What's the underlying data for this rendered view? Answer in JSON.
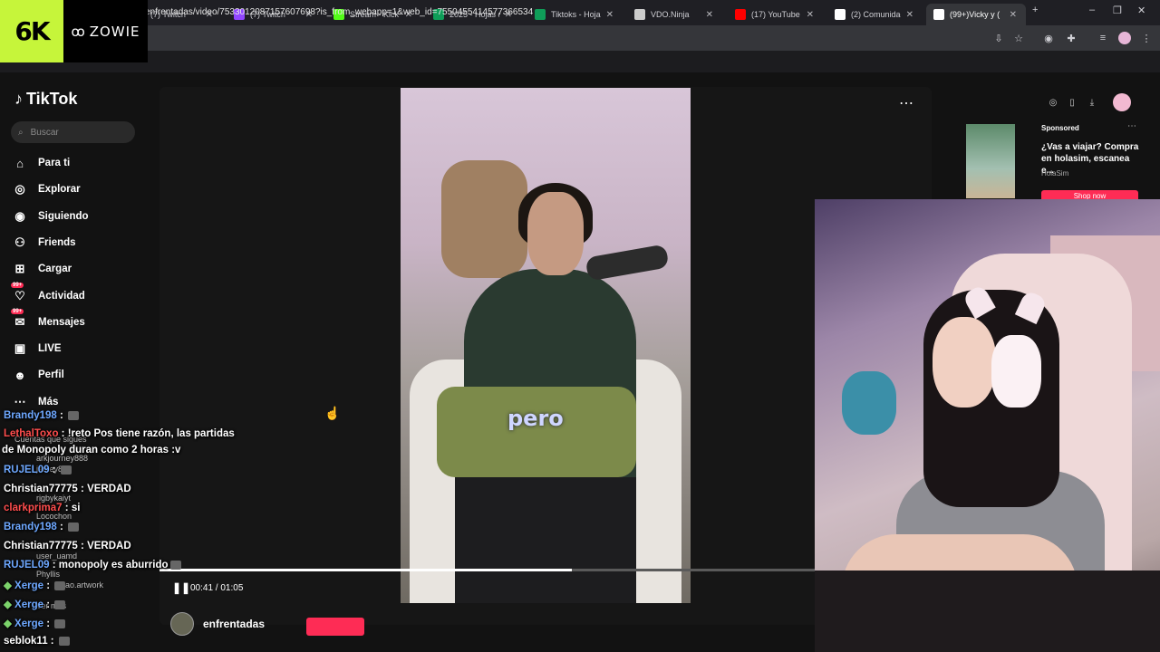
{
  "browser": {
    "tabs": [
      {
        "label": "(7) Twitch",
        "icon": "twitch-icon",
        "color": "#9146ff"
      },
      {
        "label": "(7) Twitch",
        "icon": "twitch-icon",
        "color": "#9146ff"
      },
      {
        "label": "Stream - Kick Das",
        "icon": "kick-icon",
        "color": "#53fc18"
      },
      {
        "label": "2025 - Hojas de c",
        "icon": "sheets-icon",
        "color": "#0f9d58"
      },
      {
        "label": "Tiktoks - Hojas de",
        "icon": "sheets-icon",
        "color": "#0f9d58"
      },
      {
        "label": "VDO.Ninja",
        "icon": "ninja-icon",
        "color": "#cccccc"
      },
      {
        "label": "(17) YouTube",
        "icon": "youtube-icon",
        "color": "#ff0000"
      },
      {
        "label": "(2) Comunidad El",
        "icon": "x-icon",
        "color": "#ffffff"
      },
      {
        "label": "(99+)Vicky y (",
        "icon": "tiktok-icon",
        "color": "#ffffff"
      }
    ],
    "url": "enfrentadas/video/7533012087157607698?is_from_webapp=1&web_id=7550455414577366534"
  },
  "overlay": {
    "logo_left": "6K",
    "logo_right": "ZOWIE"
  },
  "tiktok": {
    "logo": "TikTok",
    "search_placeholder": "Buscar",
    "nav": [
      {
        "label": "Para ti",
        "icon": "home-icon"
      },
      {
        "label": "Explorar",
        "icon": "compass-icon"
      },
      {
        "label": "Siguiendo",
        "icon": "following-icon"
      },
      {
        "label": "Friends",
        "icon": "friends-icon"
      },
      {
        "label": "Cargar",
        "icon": "upload-icon"
      },
      {
        "label": "Actividad",
        "icon": "activity-icon",
        "badge": "99+"
      },
      {
        "label": "Mensajes",
        "icon": "messages-icon",
        "badge": "99+"
      },
      {
        "label": "LIVE",
        "icon": "live-icon"
      },
      {
        "label": "Perfil",
        "icon": "profile-icon"
      },
      {
        "label": "Más",
        "icon": "more-icon"
      }
    ],
    "following_header": "Cuentas que sigues",
    "following_accounts": [
      "arkjourney888",
      "jamey888",
      "rigbykaiyt",
      "Locochon",
      "user_uamd",
      "Phyllis",
      "ao.artwork",
      "Ver más"
    ],
    "video": {
      "caption": "pero",
      "time": "00:41 / 01:05",
      "progress": 0.63,
      "author": "enfrentadas"
    },
    "ad": {
      "sponsored": "Sponsored",
      "text": "¿Vas a viajar? Compra en holasim, escanea e...",
      "brand": "HolaSim",
      "button": "Shop now"
    }
  },
  "chat": [
    {
      "user": "Brandy198",
      "text": "",
      "color": "#6ea8ff"
    },
    {
      "user": "LethalToxo",
      "text": "!reto Pos tiene razón, las partidas",
      "color": "#ff4d4d"
    },
    {
      "user": "",
      "text": "de Monopoly duran como 2 horas :v",
      "color": "#ffffff"
    },
    {
      "user": "RUJEL09",
      "text": "",
      "color": "#6ea8ff"
    },
    {
      "user": "Christian77775",
      "text": "VERDAD",
      "color": "#ffffff"
    },
    {
      "user": "clarkprima7",
      "text": "si",
      "color": "#ff4d4d"
    },
    {
      "user": "Brandy198",
      "text": "",
      "color": "#6ea8ff"
    },
    {
      "user": "Christian77775",
      "text": "VERDAD",
      "color": "#ffffff"
    },
    {
      "user": "RUJEL09",
      "text": "monopoly es aburrido",
      "color": "#6ea8ff"
    },
    {
      "user": "Xerge",
      "text": "",
      "color": "#6ea8ff"
    },
    {
      "user": "Xerge",
      "text": "",
      "color": "#6ea8ff"
    },
    {
      "user": "Xerge",
      "text": "",
      "color": "#6ea8ff"
    },
    {
      "user": "seblok11",
      "text": "",
      "color": "#ffffff"
    }
  ]
}
